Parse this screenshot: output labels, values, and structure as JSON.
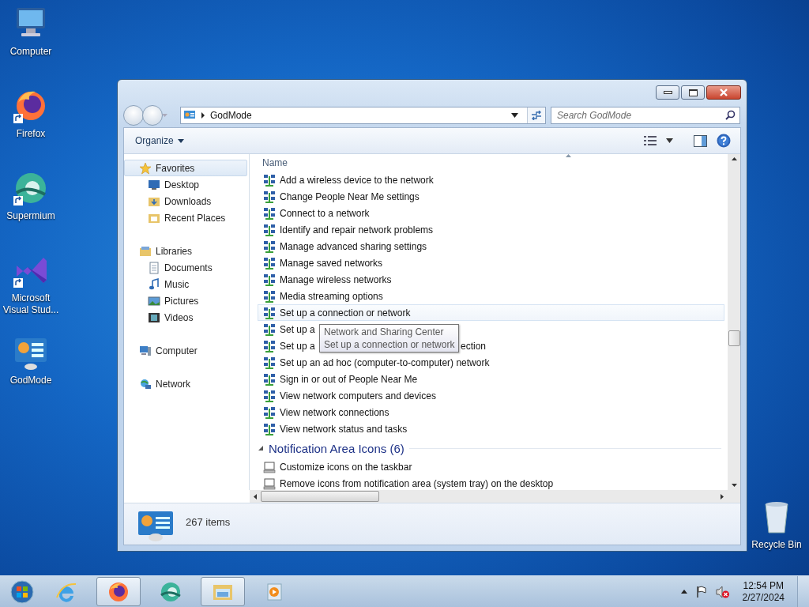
{
  "desktop_icons": [
    {
      "label": "Computer",
      "kind": "computer",
      "shortcut": false
    },
    {
      "label": "Firefox",
      "kind": "firefox",
      "shortcut": true
    },
    {
      "label": "Supermium",
      "kind": "supermium",
      "shortcut": true
    },
    {
      "label": "Microsoft Visual Stud...",
      "kind": "vs",
      "shortcut": true
    },
    {
      "label": "GodMode",
      "kind": "godmode",
      "shortcut": false
    }
  ],
  "recycle_bin": {
    "label": "Recycle Bin"
  },
  "window": {
    "path": "GodMode",
    "search": {
      "placeholder": "Search GodMode"
    },
    "organize": "Organize"
  },
  "nav": [
    {
      "label": "Favorites",
      "kind": "star",
      "selected": true,
      "children": [
        {
          "label": "Desktop",
          "kind": "desktop",
          "selected": false
        },
        {
          "label": "Downloads",
          "kind": "folder",
          "selected": false
        },
        {
          "label": "Recent Places",
          "kind": "recent",
          "selected": false
        }
      ]
    },
    {
      "label": "Libraries",
      "kind": "library",
      "selected": false,
      "children": [
        {
          "label": "Documents",
          "kind": "document",
          "selected": false
        },
        {
          "label": "Music",
          "kind": "music",
          "selected": false
        },
        {
          "label": "Pictures",
          "kind": "picture",
          "selected": false
        },
        {
          "label": "Videos",
          "kind": "video",
          "selected": false
        }
      ]
    },
    {
      "label": "Computer",
      "kind": "computer",
      "selected": false
    },
    {
      "label": "Network",
      "kind": "network",
      "selected": false
    }
  ],
  "list": {
    "column": "Name",
    "rows": [
      {
        "label": "Add a wireless device to the network",
        "hovered": false
      },
      {
        "label": "Change People Near Me settings",
        "hovered": false
      },
      {
        "label": "Connect to a network",
        "hovered": false
      },
      {
        "label": "Identify and repair network problems",
        "hovered": false
      },
      {
        "label": "Manage advanced sharing settings",
        "hovered": false
      },
      {
        "label": "Manage saved networks",
        "hovered": false
      },
      {
        "label": "Manage wireless networks",
        "hovered": false
      },
      {
        "label": "Media streaming options",
        "hovered": false
      },
      {
        "label": "Set up a connection or network",
        "hovered": true
      },
      {
        "label": "Set up a",
        "hovered": false
      },
      {
        "label": "Set up a",
        "tail": "ection",
        "hovered": false
      },
      {
        "label": "Set up an ad hoc (computer-to-computer) network",
        "hovered": false
      },
      {
        "label": "Sign in or out of People Near Me",
        "hovered": false
      },
      {
        "label": "View network computers and devices",
        "hovered": false
      },
      {
        "label": "View network connections",
        "hovered": false
      },
      {
        "label": "View network status and tasks",
        "hovered": false
      }
    ],
    "group": {
      "label": "Notification Area Icons (6)",
      "expanded": true,
      "rows": [
        {
          "label": "Customize icons on the taskbar",
          "hovered": false
        },
        {
          "label": "Remove icons from notification area (system tray) on the desktop",
          "hovered": false
        }
      ]
    }
  },
  "tooltip": {
    "lines": [
      "Network and Sharing Center",
      "Set up a connection or network"
    ]
  },
  "status": {
    "count": "267 items"
  },
  "taskbar": {
    "apps": [
      {
        "kind": "ie",
        "active": false
      },
      {
        "kind": "firefox",
        "active": true
      },
      {
        "kind": "supermium",
        "active": false
      },
      {
        "kind": "explorer",
        "active": true
      },
      {
        "kind": "media",
        "active": false
      }
    ],
    "clock": {
      "time": "12:54 PM",
      "date": "2/27/2024"
    }
  }
}
